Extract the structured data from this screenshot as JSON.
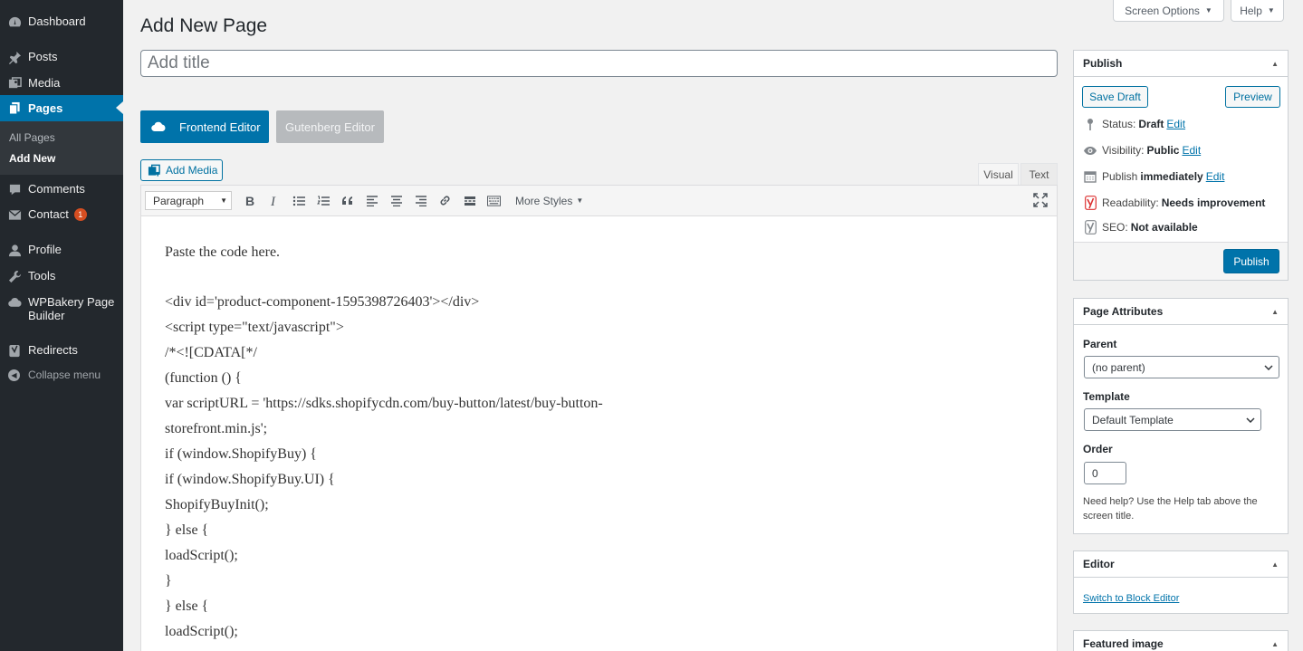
{
  "sidebar": {
    "items": [
      {
        "label": "Dashboard",
        "icon": "dashboard-icon"
      },
      {
        "label": "Posts",
        "icon": "pin-icon"
      },
      {
        "label": "Media",
        "icon": "media-icon"
      },
      {
        "label": "Pages",
        "icon": "page-icon"
      },
      {
        "label": "Comments",
        "icon": "comment-icon"
      },
      {
        "label": "Contact",
        "icon": "mail-icon",
        "badge": "1"
      },
      {
        "label": "Profile",
        "icon": "user-icon"
      },
      {
        "label": "Tools",
        "icon": "wrench-icon"
      },
      {
        "label": "WPBakery Page Builder",
        "icon": "wpbakery-icon"
      },
      {
        "label": "Redirects",
        "icon": "yoast-icon"
      }
    ],
    "submenu": [
      "All Pages",
      "Add New"
    ],
    "collapse_label": "Collapse menu"
  },
  "screen_meta": {
    "screen_options": "Screen Options",
    "help": "Help"
  },
  "page_title": "Add New Page",
  "title_field": {
    "placeholder": "Add title",
    "value": ""
  },
  "builder": {
    "frontend_label": "Frontend Editor",
    "gutenberg_label": "Gutenberg Editor"
  },
  "media": {
    "add_media_label": "Add Media"
  },
  "editor_tabs": {
    "visual": "Visual",
    "text": "Text"
  },
  "toolbar": {
    "format_value": "Paragraph",
    "more_styles": "More Styles"
  },
  "content": {
    "intro": "Paste the code here.",
    "lines": [
      "<div id='product-component-1595398726403'></div>",
      "<script type=\"text/javascript\">",
      "/*<![CDATA[*/",
      "(function () {",
      "var scriptURL = 'https://sdks.shopifycdn.com/buy-button/latest/buy-button-",
      "storefront.min.js';",
      "if (window.ShopifyBuy) {",
      "if (window.ShopifyBuy.UI) {",
      "ShopifyBuyInit();",
      "} else {",
      "loadScript();",
      "}",
      "} else {",
      "loadScript();"
    ]
  },
  "publish": {
    "heading": "Publish",
    "save_draft": "Save Draft",
    "preview": "Preview",
    "status_label": "Status:",
    "status_value": "Draft",
    "visibility_label": "Visibility:",
    "visibility_value": "Public",
    "publish_label": "Publish",
    "publish_value": "immediately",
    "edit": "Edit",
    "readability_label": "Readability:",
    "readability_value": "Needs improvement",
    "seo_label": "SEO:",
    "seo_value": "Not available",
    "publish_button": "Publish"
  },
  "page_attributes": {
    "heading": "Page Attributes",
    "parent_label": "Parent",
    "parent_value": "(no parent)",
    "template_label": "Template",
    "template_value": "Default Template",
    "order_label": "Order",
    "order_value": "0",
    "help": "Need help? Use the Help tab above the screen title."
  },
  "editor_box": {
    "heading": "Editor",
    "switch_link": "Switch to Block Editor"
  },
  "featured_image": {
    "heading": "Featured image"
  },
  "colors": {
    "admin_bar": "#23282d",
    "accent": "#0073aa",
    "badge": "#d54e21",
    "readability_bad": "#dc3232"
  }
}
